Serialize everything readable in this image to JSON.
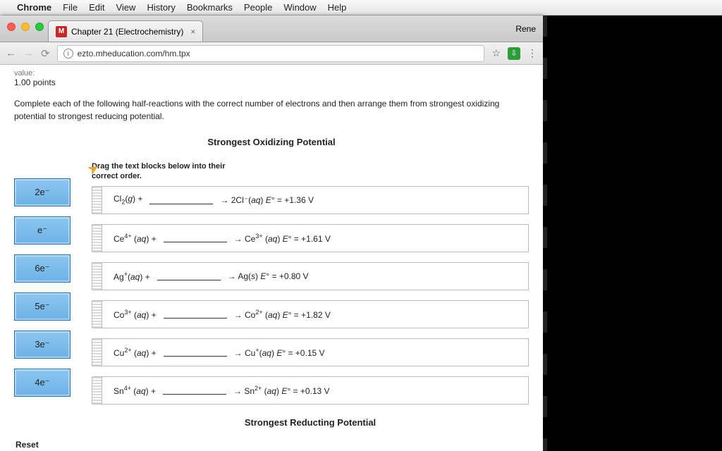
{
  "menubar": {
    "items": [
      "Chrome",
      "File",
      "Edit",
      "View",
      "History",
      "Bookmarks",
      "People",
      "Window",
      "Help"
    ]
  },
  "tab": {
    "favicon_letter": "M",
    "title": "Chapter 21 (Electrochemistry)",
    "profile": "Rene"
  },
  "url": "ezto.mheducation.com/hm.tpx",
  "value_label": "value:",
  "points": "1.00 points",
  "question": "Complete each of the following half-reactions with the correct number of electrons and then arrange them from strongest oxidizing potential to strongest reducing potential.",
  "top_label": "Strongest Oxidizing Potential",
  "hint": "Drag the text blocks below into their correct order.",
  "electron_blocks": [
    "2e⁻",
    "e⁻",
    "6e⁻",
    "5e⁻",
    "3e⁻",
    "4e⁻"
  ],
  "reactions": [
    {
      "left_html": "Cl<sub>2</sub>(<i>g</i>) +",
      "right_html": "→ 2Cl⁻(<i>aq</i>) <i>E</i>° = +1.36 V"
    },
    {
      "left_html": "Ce<sup>4+</sup> (<i>aq</i>) +",
      "right_html": "→ Ce<sup>3+</sup> (<i>aq</i>) <i>E</i>° = +1.61 V"
    },
    {
      "left_html": "Ag<sup>+</sup>(<i>aq</i>) +",
      "right_html": "→ Ag(<i>s</i>) <i>E</i>° = +0.80 V"
    },
    {
      "left_html": "Co<sup>3+</sup> (<i>aq</i>) +",
      "right_html": "→ Co<sup>2+</sup> (<i>aq</i>) <i>E</i>° = +1.82 V"
    },
    {
      "left_html": "Cu<sup>2+</sup> (<i>aq</i>) +",
      "right_html": "→ Cu<sup>+</sup>(<i>aq</i>) <i>E</i>° = +0.15 V"
    },
    {
      "left_html": "Sn<sup>4+</sup> (<i>aq</i>) +",
      "right_html": "→ Sn<sup>2+</sup> (<i>aq</i>) <i>E</i>° = +0.13 V"
    }
  ],
  "bottom_label": "Strongest Reducting Potential",
  "reset_label": "Reset"
}
